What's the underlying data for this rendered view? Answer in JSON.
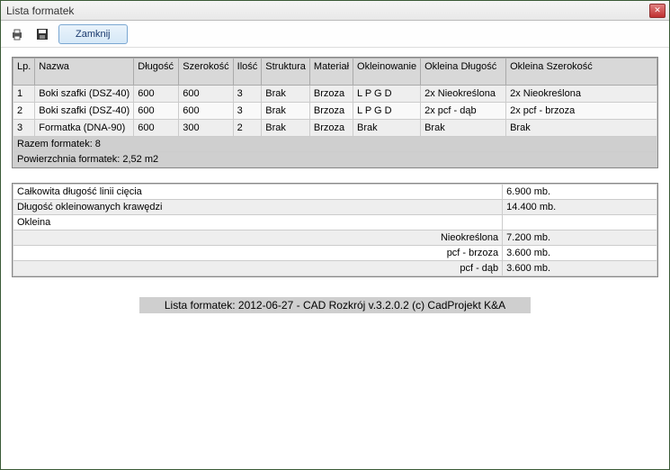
{
  "window": {
    "title": "Lista formatek"
  },
  "toolbar": {
    "close_label": "Zamknij"
  },
  "table": {
    "headers": {
      "lp": "Lp.",
      "nazwa": "Nazwa",
      "dlugosc": "Długość",
      "szerokosc": "Szerokość",
      "ilosc": "Ilość",
      "struktura": "Struktura",
      "material": "Materiał",
      "okleinowanie": "Okleinowanie",
      "okleina_dl": "Okleina Długość",
      "okleina_sz": "Okleina Szerokość"
    },
    "rows": [
      {
        "lp": "1",
        "nazwa": "Boki szafki (DSZ-40)",
        "dl": "600",
        "sz": "600",
        "il": "3",
        "str": "Brak",
        "mat": "Brzoza",
        "okl": "L P G D",
        "okl_dl": "2x Nieokreślona",
        "okl_sz": "2x Nieokreślona"
      },
      {
        "lp": "2",
        "nazwa": "Boki szafki (DSZ-40)",
        "dl": "600",
        "sz": "600",
        "il": "3",
        "str": "Brak",
        "mat": "Brzoza",
        "okl": "L P G D",
        "okl_dl": "2x pcf - dąb",
        "okl_sz": "2x pcf - brzoza"
      },
      {
        "lp": "3",
        "nazwa": "Formatka (DNA-90)",
        "dl": "600",
        "sz": "300",
        "il": "2",
        "str": "Brak",
        "mat": "Brzoza",
        "okl": "Brak",
        "okl_dl": "Brak",
        "okl_sz": "Brak"
      }
    ],
    "summary1": "Razem formatek: 8",
    "summary2": "Powierzchnia formatek: 2,52 m2"
  },
  "stats": {
    "rows": [
      {
        "label": "Całkowita długość linii cięcia",
        "val": "6.900 mb."
      },
      {
        "label": "Długość okleinowanych krawędzi",
        "val": "14.400 mb."
      },
      {
        "label": "Okleina",
        "val": ""
      }
    ],
    "sub": [
      {
        "label": "Nieokreślona",
        "val": "7.200 mb."
      },
      {
        "label": "pcf - brzoza",
        "val": "3.600 mb."
      },
      {
        "label": "pcf - dąb",
        "val": "3.600 mb."
      }
    ]
  },
  "footer": "Lista formatek: 2012-06-27 - CAD Rozkrój v.3.2.0.2 (c) CadProjekt K&A"
}
